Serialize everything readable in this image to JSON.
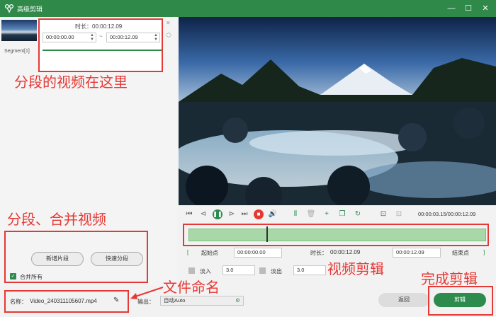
{
  "window": {
    "title": "高级剪辑",
    "minimize": "—",
    "maximize": "☐",
    "close": "✕"
  },
  "segments": {
    "thumb_label": "Segment[1]",
    "duration_text": "时长：00:00:12.09",
    "start_time": "00:00:00.00",
    "end_time": "00:00:12.09",
    "separator": "~"
  },
  "left_panel": {
    "add_segment_label": "新增片段",
    "quick_split_label": "快速分段",
    "merge_all_label": "合并所有",
    "merge_all_checked": true
  },
  "file": {
    "name_label": "名称：",
    "name_value": "Video_240311105607.mp4",
    "output_label": "输出：",
    "output_value": "自动Auto"
  },
  "player": {
    "time_readout": "00:00:03.15/00:00:12.09",
    "playhead_fraction": 0.26,
    "record_color": "#e53935",
    "play_color": "#2e8b4e"
  },
  "clip": {
    "start_button": "起始点",
    "start_time": "00:00:00.00",
    "duration_label": "时长：",
    "duration_value": "00:00:12.09",
    "end_time": "00:00:12.09",
    "end_button": "结束点",
    "fade_in_label": "淡入",
    "fade_in_value": "3.0",
    "fade_out_label": "淡出",
    "fade_out_value": "3.0"
  },
  "actions": {
    "back_label": "返回",
    "cut_label": "剪辑",
    "accent": "#2e8b4e"
  },
  "annotations": {
    "segments_here": "分段的视频在这里",
    "split_merge": "分段、合并视频",
    "file_naming": "文件命名",
    "video_edit": "视频剪辑",
    "finish_edit": "完成剪辑"
  }
}
